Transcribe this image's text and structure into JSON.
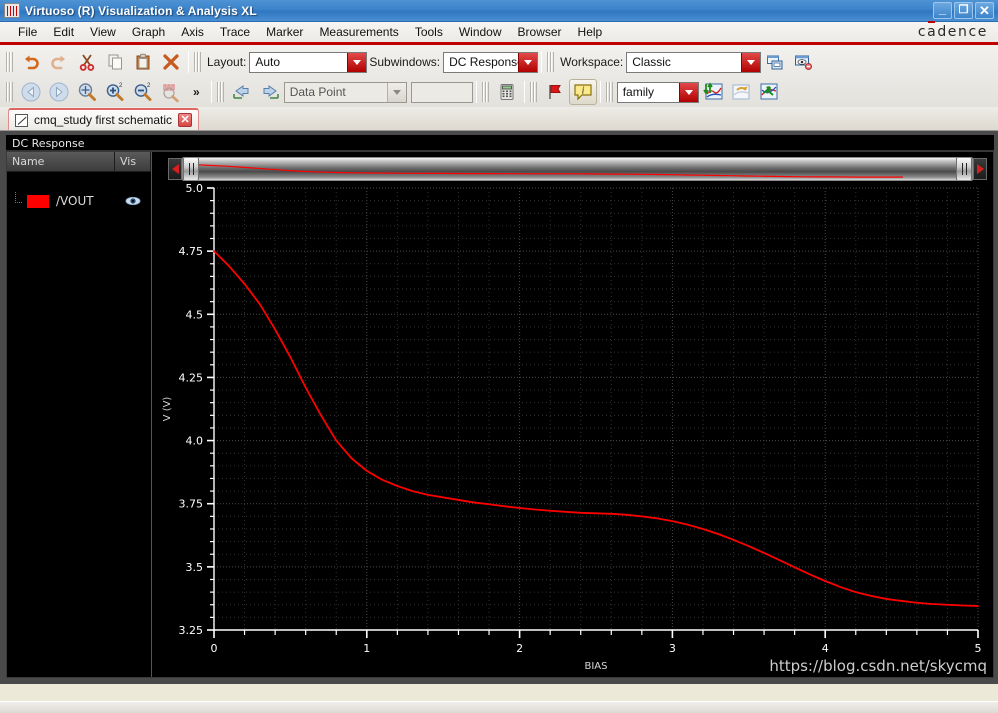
{
  "window": {
    "title": "Virtuoso (R) Visualization & Analysis XL",
    "app_icon": "waveform-icon",
    "minimize_label": "_",
    "restore_label": "❐",
    "close_label": "✕",
    "brand": "cadence"
  },
  "menubar": {
    "items": [
      {
        "label": "File",
        "mnemonic": "F"
      },
      {
        "label": "Edit",
        "mnemonic": "E"
      },
      {
        "label": "View",
        "mnemonic": "V"
      },
      {
        "label": "Graph",
        "mnemonic": "G"
      },
      {
        "label": "Axis",
        "mnemonic": "A"
      },
      {
        "label": "Trace",
        "mnemonic": "T"
      },
      {
        "label": "Marker",
        "mnemonic": "M"
      },
      {
        "label": "Measurements",
        "mnemonic": "e"
      },
      {
        "label": "Tools",
        "mnemonic": "o"
      },
      {
        "label": "Window",
        "mnemonic": "W"
      },
      {
        "label": "Browser",
        "mnemonic": "B"
      },
      {
        "label": "Help",
        "mnemonic": "H"
      }
    ]
  },
  "toolbar_row1": {
    "buttons": [
      {
        "name": "undo-icon",
        "title": "Undo"
      },
      {
        "name": "redo-icon",
        "title": "Redo"
      },
      {
        "name": "cut-icon",
        "title": "Cut"
      },
      {
        "name": "copy-icon",
        "title": "Copy"
      },
      {
        "name": "paste-icon",
        "title": "Paste"
      },
      {
        "name": "delete-icon",
        "title": "Delete"
      }
    ],
    "layout_label": "Layout:",
    "layout_value": "Auto",
    "subwindows_label": "Subwindows:",
    "subwindows_value": "DC Response",
    "workspace_label": "Workspace:",
    "workspace_value": "Classic",
    "save_workspace_icon": "save-window-icon",
    "hide_workspace_icon": "hide-window-icon"
  },
  "toolbar_row2": {
    "nav_buttons": [
      {
        "name": "back-arrow-icon",
        "title": "Back"
      },
      {
        "name": "forward-arrow-icon",
        "title": "Forward"
      },
      {
        "name": "zoom-fit-icon",
        "title": "Zoom Fit"
      },
      {
        "name": "zoom-in-icon",
        "title": "Zoom In"
      },
      {
        "name": "zoom-out-icon",
        "title": "Zoom Out"
      },
      {
        "name": "zoom-waveform-icon",
        "title": "Zoom Waveform"
      }
    ],
    "overflow_label": "»",
    "marker_prev_icon": "marker-prev-icon",
    "marker_next_icon": "marker-next-icon",
    "marker_mode_value": "Data Point",
    "marker_field_value": "",
    "calculator_icon": "calculator-icon",
    "flag_icon": "flag-icon",
    "info_icon": "info-balloon-icon",
    "family_value": "family",
    "split_icon": "split-graph-icon",
    "swap_icon": "swap-graph-icon",
    "overlay_icon": "overlay-graph-icon"
  },
  "tab": {
    "icon": "schematic-icon",
    "label": "cmq_study first schematic",
    "close_label": "✕"
  },
  "subwindow": {
    "title": "DC Response"
  },
  "tree": {
    "columns": [
      "Name",
      "Vis"
    ],
    "rows": [
      {
        "name": "/VOUT",
        "color": "#ff0000",
        "visible": true,
        "vis_icon": "eye-icon"
      }
    ]
  },
  "scrollbar": {
    "left_arrow_icon": "scroll-left-arrow-icon",
    "right_arrow_icon": "scroll-right-arrow-icon"
  },
  "watermark": {
    "text": "https://blog.csdn.net/skycmq"
  },
  "colors": {
    "trace": "#ff0000",
    "plot_background": "#000000",
    "grid": "#4a4a4a",
    "axis_text": "#ffffff",
    "accent_red": "#c00000",
    "titlebar_blue": "#3b82c9"
  },
  "chart_data": {
    "type": "line",
    "title": "DC Response",
    "xlabel": "BIAS",
    "ylabel": "V (V)",
    "xlim": [
      0,
      5
    ],
    "ylim": [
      3.25,
      5.0
    ],
    "xticks": [
      0,
      1,
      2,
      3,
      4,
      5
    ],
    "xticklabels": [
      "0",
      "1",
      "2",
      "3",
      "4",
      "5"
    ],
    "yticks": [
      3.25,
      3.5,
      3.75,
      4.0,
      4.25,
      4.5,
      4.75,
      5.0
    ],
    "yticklabels": [
      "3.25",
      "3.5",
      "3.75",
      "4.0",
      "4.25",
      "4.5",
      "4.75",
      "5.0"
    ],
    "minor_ticks_per_interval": 5,
    "grid": true,
    "grid_style": "dotted",
    "legend": false,
    "series": [
      {
        "name": "/VOUT",
        "color": "#ff0000",
        "x": [
          0.0,
          0.1,
          0.2,
          0.3,
          0.4,
          0.5,
          0.6,
          0.7,
          0.8,
          0.9,
          1.0,
          1.1,
          1.2,
          1.3,
          1.4,
          1.5,
          1.6,
          1.7,
          1.8,
          1.9,
          2.0,
          2.1,
          2.2,
          2.3,
          2.4,
          2.5,
          2.6,
          2.7,
          2.8,
          2.9,
          3.0,
          3.1,
          3.2,
          3.3,
          3.4,
          3.5,
          3.6,
          3.7,
          3.8,
          3.9,
          4.0,
          4.1,
          4.2,
          4.3,
          4.4,
          4.5,
          4.6,
          4.7,
          4.8,
          4.9,
          5.0
        ],
        "y": [
          4.75,
          4.69,
          4.62,
          4.54,
          4.44,
          4.33,
          4.21,
          4.1,
          4.0,
          3.93,
          3.88,
          3.845,
          3.82,
          3.8,
          3.785,
          3.775,
          3.765,
          3.755,
          3.748,
          3.74,
          3.733,
          3.727,
          3.722,
          3.718,
          3.714,
          3.712,
          3.71,
          3.706,
          3.7,
          3.692,
          3.681,
          3.667,
          3.65,
          3.63,
          3.607,
          3.582,
          3.555,
          3.527,
          3.498,
          3.47,
          3.444,
          3.42,
          3.4,
          3.385,
          3.373,
          3.365,
          3.358,
          3.353,
          3.35,
          3.347,
          3.345
        ]
      }
    ]
  }
}
